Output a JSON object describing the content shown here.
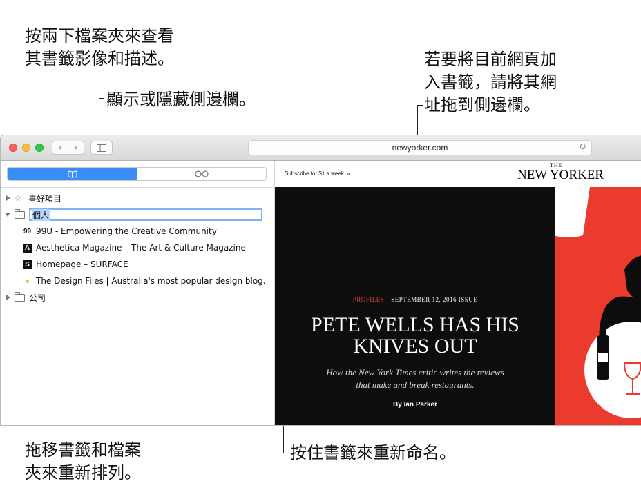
{
  "callouts": {
    "top_left": "按兩下檔案夾來查看\n其書籤影像和描述。",
    "top_mid": "顯示或隱藏側邊欄。",
    "top_right": "若要將目前網頁加\n入書籤，請將其網\n址拖到側邊欄。",
    "bottom_left": "拖移書籤和檔案\n夾來重新排列。",
    "bottom_mid": "按住書籤來重新命名。"
  },
  "toolbar": {
    "back_icon": "chevron-left-icon",
    "forward_icon": "chevron-right-icon",
    "sidebar_toggle_icon": "sidebar-icon",
    "url": "newyorker.com",
    "reader_icon": "reader-icon",
    "reload_glyph": "↻"
  },
  "sidebar": {
    "tabs": [
      {
        "label": "📖",
        "icon": "book-icon",
        "selected": true
      },
      {
        "label": "○○",
        "icon": "reading-list-icon",
        "selected": false
      }
    ],
    "favorites_label": "喜好項目",
    "personal_folder": "個人",
    "bookmarks": [
      {
        "icon_text": "99",
        "label": "99U - Empowering the Creative Community"
      },
      {
        "icon_text": "A",
        "label": "Aesthetica Magazine – The Art & Culture Magazine"
      },
      {
        "icon_text": "S",
        "label": "Homepage – SURFACE"
      },
      {
        "icon_text": "",
        "label": "The Design Files | Australia's most popular design blog."
      }
    ],
    "company_folder": "公司"
  },
  "page": {
    "subscribe": "Subscribe for $1 a week. »",
    "logo_the": "THE",
    "logo": "NEW YORKER",
    "kicker_section": "PROFILES",
    "kicker_issue": "SEPTEMBER 12, 2016 ISSUE",
    "headline": "PETE WELLS HAS HIS\nKNIVES OUT",
    "dek": "How the New York Times critic writes the reviews\nthat make and break restaurants.",
    "byline": "By Ian Parker"
  },
  "colors": {
    "accent": "#3b8ef6",
    "hero_bg": "#0d0d0d",
    "art_red": "#ea3b2e",
    "kicker_red": "#e2452a"
  }
}
